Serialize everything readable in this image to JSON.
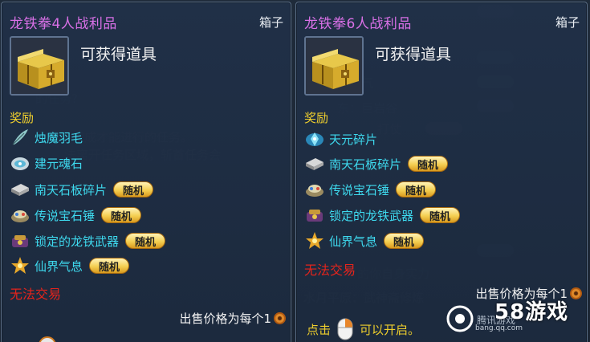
{
  "tooltips": [
    {
      "title": "龙铁拳4人战利品",
      "type": "箱子",
      "obtain_text": "可获得道具",
      "reward_label": "奖励",
      "items": [
        {
          "name": "烛魔羽毛",
          "random": false,
          "icon": "feather-icon"
        },
        {
          "name": "建元魂石",
          "random": false,
          "icon": "soul-stone-icon"
        },
        {
          "name": "南天石板碎片",
          "random": true,
          "icon": "stone-slab-icon"
        },
        {
          "name": "传说宝石锤",
          "random": true,
          "icon": "gem-hammer-icon"
        },
        {
          "name": "锁定的龙铁武器",
          "random": true,
          "icon": "weapon-bundle-icon"
        },
        {
          "name": "仙界气息",
          "random": true,
          "icon": "fairy-aura-icon"
        }
      ],
      "random_label": "随机",
      "untradable": "无法交易",
      "price_text": "出售价格为每个1"
    },
    {
      "title": "龙铁拳6人战利品",
      "type": "箱子",
      "obtain_text": "可获得道具",
      "reward_label": "奖励",
      "items": [
        {
          "name": "天元碎片",
          "random": false,
          "icon": "crystal-shard-icon"
        },
        {
          "name": "南天石板碎片",
          "random": true,
          "icon": "stone-slab-icon"
        },
        {
          "name": "传说宝石锤",
          "random": true,
          "icon": "gem-hammer-icon"
        },
        {
          "name": "锁定的龙铁武器",
          "random": true,
          "icon": "weapon-bundle-icon"
        },
        {
          "name": "仙界气息",
          "random": true,
          "icon": "fairy-aura-icon"
        }
      ],
      "random_label": "随机",
      "untradable": "无法交易",
      "price_text": "出售价格为每个1",
      "open_hint_prefix": "点击",
      "open_hint_suffix": "可以开启。"
    }
  ],
  "watermark": {
    "name": "58游戏",
    "subtitle": "腾讯游戏",
    "url": "bang.qq.com"
  },
  "colors": {
    "title": "#d870e6",
    "item": "#3ed9ee",
    "reward": "#efcf2d",
    "untradable": "#e4241c"
  }
}
